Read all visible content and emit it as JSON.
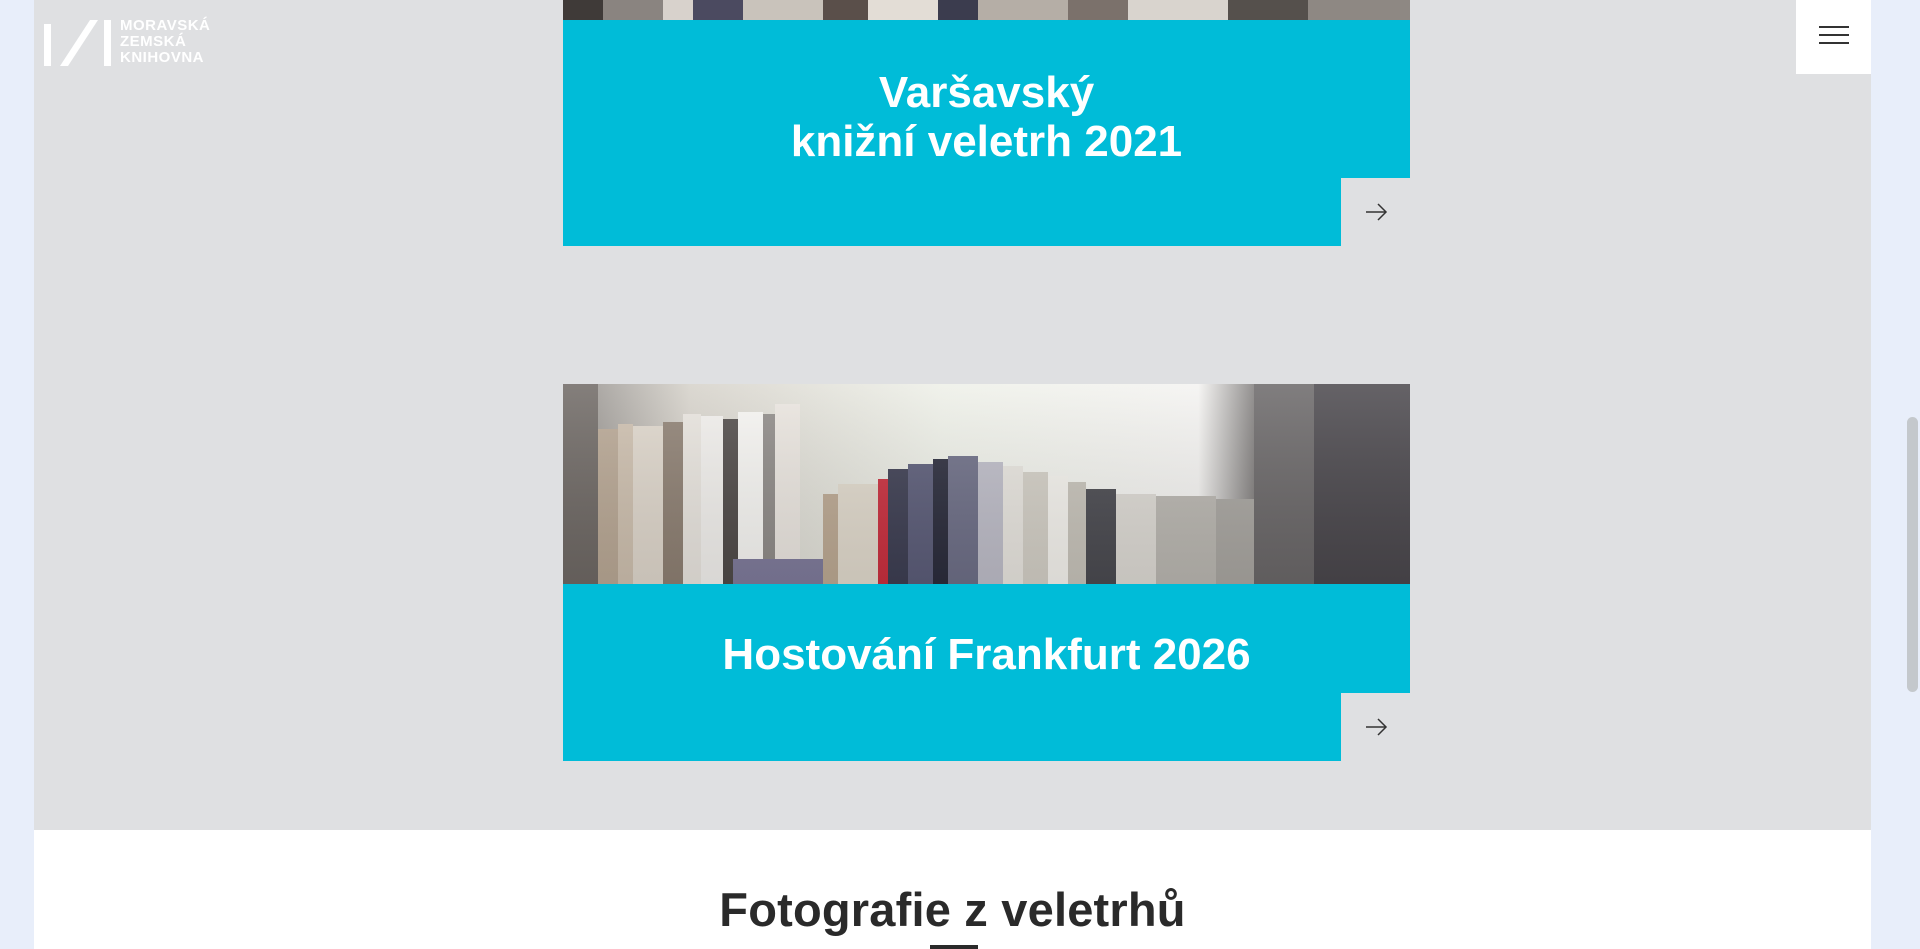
{
  "logo": {
    "lines": [
      "MORAVSKÁ",
      "ZEMSKÁ",
      "KNIHOVNA"
    ]
  },
  "menu": {
    "icon": "hamburger-icon"
  },
  "cards": [
    {
      "title_lines": [
        "Varšavský",
        "knižní veletrh 2021"
      ],
      "arrow_icon": "arrow-right-icon"
    },
    {
      "title_lines": [
        "Hostování Frankfurt 2026"
      ],
      "arrow_icon": "arrow-right-icon"
    }
  ],
  "section": {
    "title": "Fotografie z veletrhů"
  },
  "colors": {
    "accent": "#00bcd8",
    "page_background": "#dfe0e2",
    "outer_background": "#e8eefa",
    "heading": "#2a2a2a"
  }
}
